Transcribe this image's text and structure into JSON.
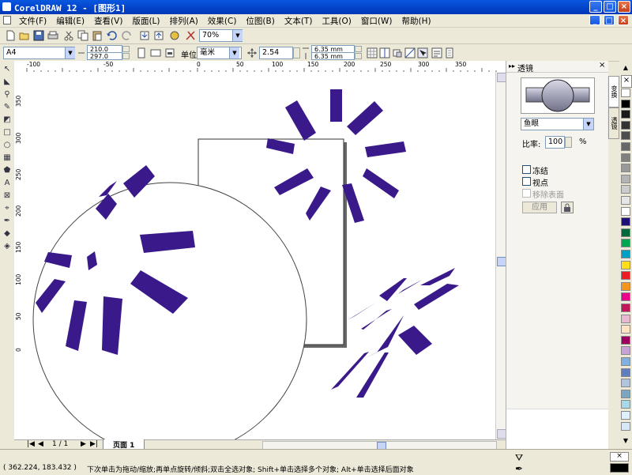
{
  "window": {
    "title": "CorelDRAW 12 - [图形1]"
  },
  "menu": [
    "文件(F)",
    "编辑(E)",
    "查看(V)",
    "版面(L)",
    "排列(A)",
    "效果(C)",
    "位图(B)",
    "文本(T)",
    "工具(O)",
    "窗口(W)",
    "帮助(H)"
  ],
  "toolbar": {
    "zoom": "70%"
  },
  "propbar": {
    "paper": "A4",
    "width": "210.0 mm",
    "height": "297.0 mm",
    "units_label": "单位:",
    "units": "毫米",
    "nudge": "2.54 mm",
    "dup_x": "6.35 mm",
    "dup_y": "6.35 mm"
  },
  "ruler": {
    "h_ticks": [
      "-100",
      "-50",
      "0",
      "50",
      "100",
      "150",
      "200",
      "250",
      "300",
      "350"
    ],
    "v_ticks": [
      "350",
      "300",
      "250",
      "200",
      "150",
      "100",
      "50",
      "0"
    ]
  },
  "pagenav": {
    "count": "1 / 1",
    "tab": "页面 1"
  },
  "docker": {
    "title": "透镜",
    "lens_type": "鱼眼",
    "rate_label": "比率:",
    "rate_value": "100",
    "rate_unit": "%",
    "freeze": "冻结",
    "viewpoint": "视点",
    "remove_face": "移除表面",
    "apply": "应用",
    "tabs": [
      "变换",
      "透镜"
    ]
  },
  "palette": [
    "#ffffff",
    "#000000",
    "#1a1a1a",
    "#333333",
    "#4d4d4d",
    "#666666",
    "#808080",
    "#999999",
    "#b3b3b3",
    "#cccccc",
    "#e6e6e6",
    "#ffffff",
    "#1d0e7a",
    "#006a3a",
    "#00a651",
    "#00a0c6",
    "#ffde17",
    "#ed1c24",
    "#f7941d",
    "#ec008c",
    "#c2185b",
    "#e8b8d0",
    "#ffe4c4",
    "#9e005d",
    "#c8a2d6",
    "#7fb0e0",
    "#5e7fbf",
    "#b0c4de",
    "#7da6c2",
    "#a8d8e8",
    "#e0f0ff",
    "#d6e8f5"
  ],
  "status": {
    "coords": "( 362.224, 183.432 )",
    "message": "下次单击为拖动/缩放;再单点旋转/倾斜;双击全选对象; Shift+单击选择多个对象; Alt+单击选择后面对象"
  }
}
